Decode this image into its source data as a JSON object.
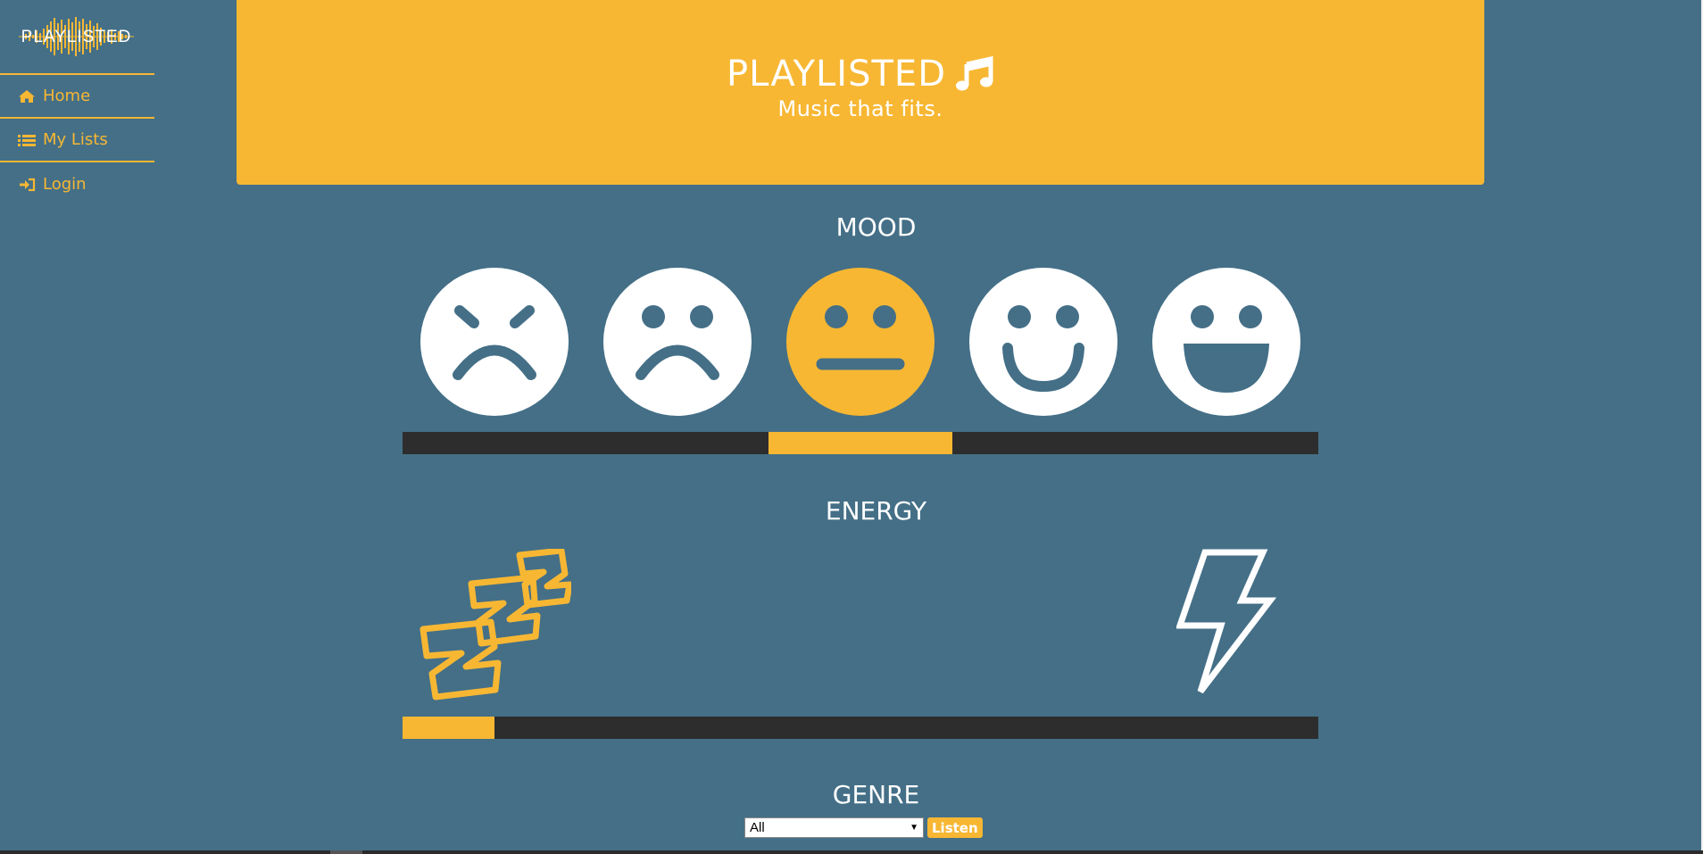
{
  "sidebar": {
    "logo_text": "PLAYLISTED",
    "items": [
      {
        "label": "Home",
        "icon": "home-icon"
      },
      {
        "label": "My Lists",
        "icon": "list-icon"
      },
      {
        "label": "Login",
        "icon": "login-icon"
      }
    ]
  },
  "hero": {
    "title": "PLAYLISTED",
    "subtitle": "Music that fits."
  },
  "mood": {
    "title": "MOOD",
    "options": [
      "angry",
      "sad",
      "neutral",
      "happy",
      "very-happy"
    ],
    "selected_index": 2,
    "level_fraction": 0.4
  },
  "energy": {
    "title": "ENERGY",
    "low_icon": "sleep-icon",
    "high_icon": "lightning-icon",
    "level_fraction": 0.1
  },
  "genre": {
    "title": "GENRE",
    "selected": "All",
    "button_label": "Listen"
  },
  "colors": {
    "background": "#446f87",
    "accent": "#f7b733",
    "track": "#2d2d2d",
    "face": "#ffffff"
  }
}
